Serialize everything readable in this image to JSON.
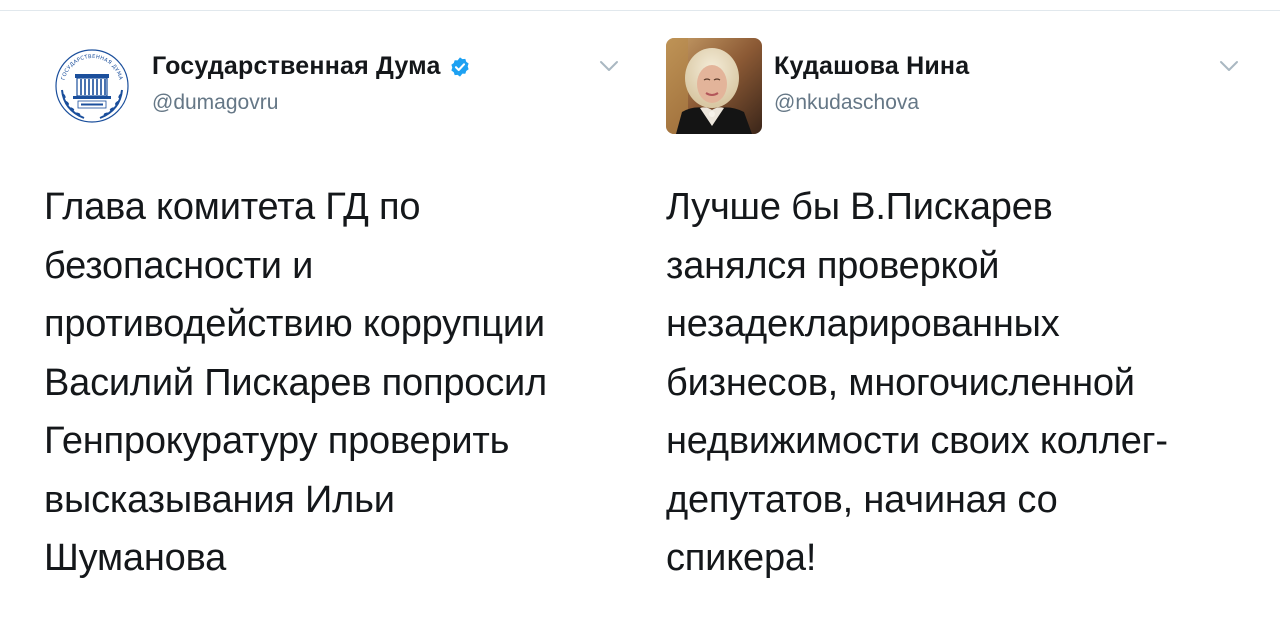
{
  "tweets": [
    {
      "display_name": "Государственная Дума",
      "verified": true,
      "handle": "@dumagovru",
      "avatar_icon": "duma-emblem-icon",
      "avatar_text": "ГОСУДАРСТВЕННАЯ ДУМА",
      "text": "Глава комитета ГД по\nбезопасности и\nпротиводействию коррупции\nВасилий Пискарев попросил\nГенпрокуратуру проверить\nвысказывания Ильи\nШуманова"
    },
    {
      "display_name": "Кудашова Нина",
      "verified": false,
      "handle": "@nkudaschova",
      "avatar_icon": "profile-photo-icon",
      "text": "Лучше бы В.Пискарев\nзанялся проверкой\nнезадекларированных\nбизнесов, многочисленной\nнедвижимости своих коллег-\nдепутатов, начиная со\nспикера!"
    }
  ],
  "colors": {
    "text": "#14171a",
    "secondary": "#657786",
    "verified": "#1da1f2",
    "divider": "#e1e8ed",
    "emblem": "#1b4f9c"
  }
}
